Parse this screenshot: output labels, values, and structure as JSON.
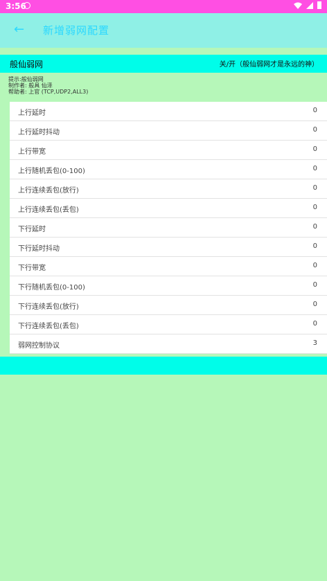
{
  "status": {
    "time": "3:56"
  },
  "appbar": {
    "title": "新增弱网配置"
  },
  "header": {
    "left": "般仙弱网",
    "right": "关/开（般仙弱网才是永远的神）"
  },
  "info": {
    "line1": "提示:般仙弱网",
    "line2": "制作者: 般具   仙泽",
    "line3": "帮助者: 上官   (TCP,UDP2,ALL3)"
  },
  "rows": [
    {
      "label": "上行延时",
      "value": "0"
    },
    {
      "label": "上行延时抖动",
      "value": "0"
    },
    {
      "label": "上行带宽",
      "value": "0"
    },
    {
      "label": "上行随机丢包(0-100)",
      "value": "0"
    },
    {
      "label": "上行连续丢包(放行)",
      "value": "0"
    },
    {
      "label": "上行连续丢包(丢包)",
      "value": "0"
    },
    {
      "label": "下行延时",
      "value": "0"
    },
    {
      "label": "下行延时抖动",
      "value": "0"
    },
    {
      "label": "下行带宽",
      "value": "0"
    },
    {
      "label": "下行随机丢包(0-100)",
      "value": "0"
    },
    {
      "label": "下行连续丢包(放行)",
      "value": "0"
    },
    {
      "label": "下行连续丢包(丢包)",
      "value": "0"
    },
    {
      "label": "弱网控制协议",
      "value": "3"
    }
  ]
}
